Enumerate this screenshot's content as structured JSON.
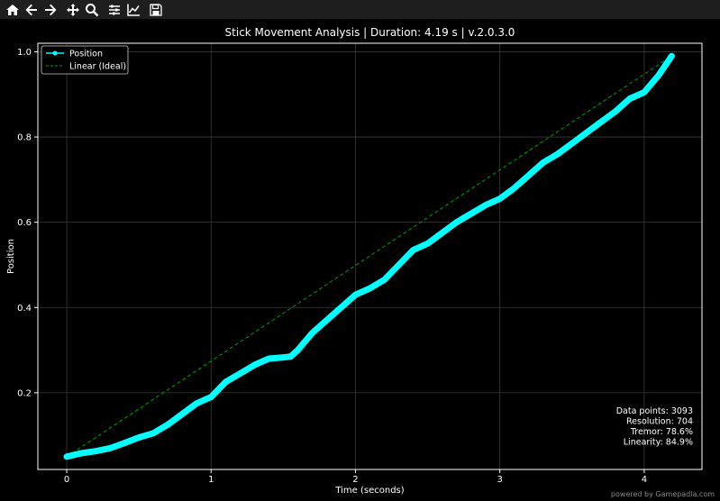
{
  "toolbar": {
    "buttons": [
      {
        "name": "home-icon",
        "label": "Home"
      },
      {
        "name": "back-icon",
        "label": "Back"
      },
      {
        "name": "forward-icon",
        "label": "Forward"
      },
      {
        "name": "pan-icon",
        "label": "Pan"
      },
      {
        "name": "zoom-icon",
        "label": "Zoom"
      },
      {
        "name": "configure-subplots-icon",
        "label": "Subplots"
      },
      {
        "name": "edit-axis-icon",
        "label": "Customize"
      },
      {
        "name": "save-icon",
        "label": "Save"
      }
    ]
  },
  "chart_data": {
    "type": "line",
    "title": "Stick Movement Analysis | Duration: 4.19 s | v.2.0.3.0",
    "xlabel": "Time (seconds)",
    "ylabel": "Position",
    "xlim": [
      -0.2,
      4.4
    ],
    "ylim": [
      0.02,
      1.02
    ],
    "xticks": [
      0,
      1,
      2,
      3,
      4
    ],
    "yticks": [
      0.2,
      0.4,
      0.6,
      0.8,
      1.0
    ],
    "xtick_labels": [
      "0",
      "1",
      "2",
      "3",
      "4"
    ],
    "ytick_labels": [
      "0.2",
      "0.4",
      "0.6",
      "0.8",
      "1.0"
    ],
    "grid": true,
    "legend_placement": "upper-left",
    "series": [
      {
        "name": "Position",
        "color": "#00ffff",
        "style": "line-with-markers",
        "points": [
          [
            0.0,
            0.05
          ],
          [
            0.1,
            0.058
          ],
          [
            0.2,
            0.063
          ],
          [
            0.3,
            0.07
          ],
          [
            0.4,
            0.082
          ],
          [
            0.5,
            0.095
          ],
          [
            0.6,
            0.105
          ],
          [
            0.7,
            0.125
          ],
          [
            0.8,
            0.15
          ],
          [
            0.9,
            0.175
          ],
          [
            1.0,
            0.19
          ],
          [
            1.1,
            0.225
          ],
          [
            1.2,
            0.245
          ],
          [
            1.3,
            0.265
          ],
          [
            1.4,
            0.28
          ],
          [
            1.5,
            0.283
          ],
          [
            1.55,
            0.285
          ],
          [
            1.6,
            0.3
          ],
          [
            1.7,
            0.34
          ],
          [
            1.8,
            0.37
          ],
          [
            1.9,
            0.4
          ],
          [
            2.0,
            0.43
          ],
          [
            2.1,
            0.445
          ],
          [
            2.2,
            0.465
          ],
          [
            2.3,
            0.5
          ],
          [
            2.4,
            0.535
          ],
          [
            2.5,
            0.55
          ],
          [
            2.6,
            0.575
          ],
          [
            2.7,
            0.6
          ],
          [
            2.8,
            0.62
          ],
          [
            2.9,
            0.64
          ],
          [
            3.0,
            0.655
          ],
          [
            3.1,
            0.68
          ],
          [
            3.2,
            0.71
          ],
          [
            3.3,
            0.74
          ],
          [
            3.4,
            0.76
          ],
          [
            3.5,
            0.785
          ],
          [
            3.6,
            0.81
          ],
          [
            3.7,
            0.835
          ],
          [
            3.8,
            0.86
          ],
          [
            3.9,
            0.89
          ],
          [
            4.0,
            0.905
          ],
          [
            4.1,
            0.945
          ],
          [
            4.19,
            0.99
          ]
        ]
      },
      {
        "name": "Linear (Ideal)",
        "color": "#00a000",
        "style": "dashed",
        "points": [
          [
            0.0,
            0.05
          ],
          [
            4.19,
            0.99
          ]
        ]
      }
    ],
    "annotations": [
      "Data points: 3093",
      "Resolution: 704",
      "Tremor: 78.6%",
      "Linearity: 84.9%"
    ]
  },
  "watermark": "powered by Gamepadla.com"
}
